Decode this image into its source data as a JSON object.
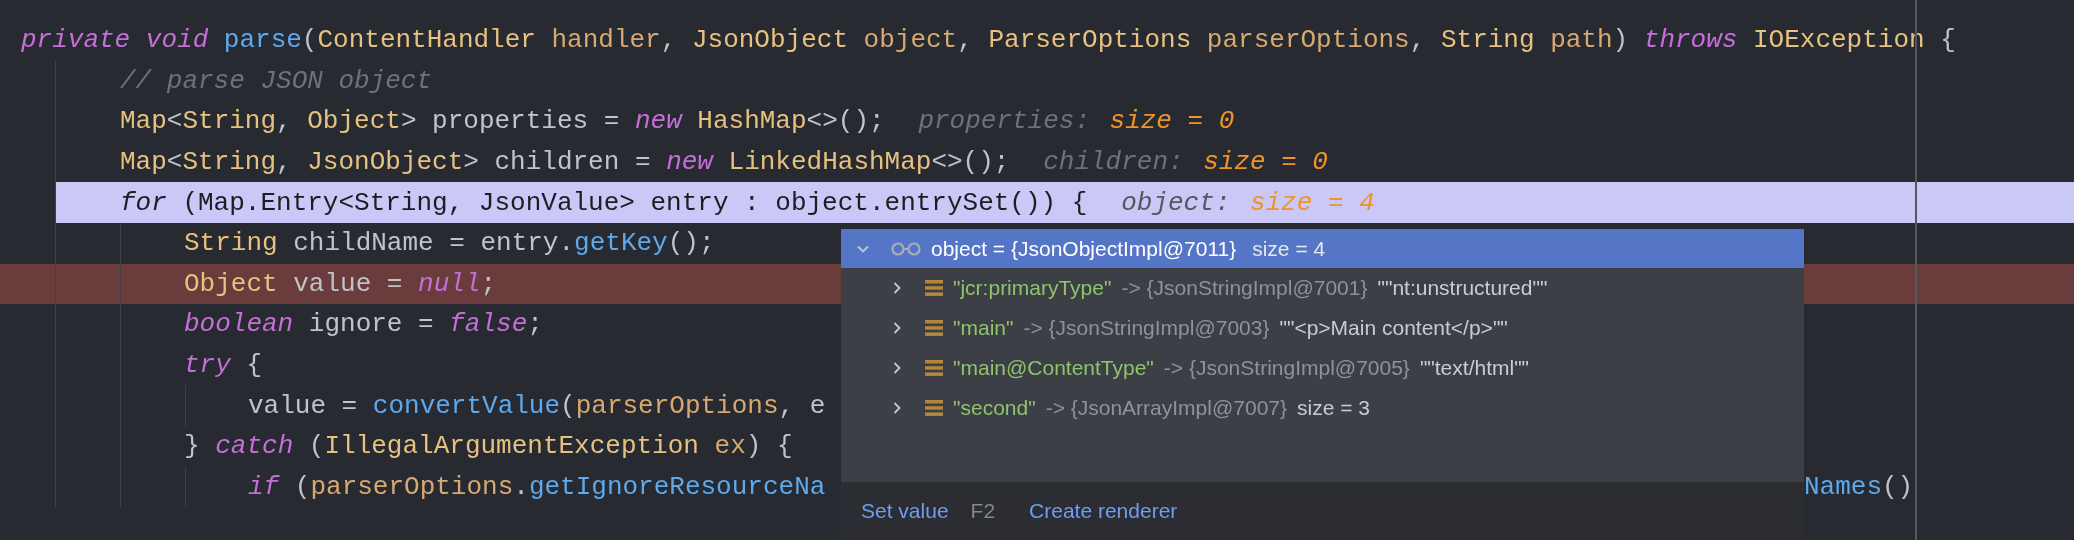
{
  "code": [
    {
      "current": false,
      "breakpoint": false,
      "segments": [
        {
          "kind": "kw",
          "text": "private"
        },
        {
          "kind": "kw",
          "text": " void"
        },
        {
          "kind": "method",
          "text": " parse"
        },
        {
          "kind": "plain",
          "text": "("
        },
        {
          "kind": "type",
          "text": "ContentHandler"
        },
        {
          "kind": "param",
          "text": " handler"
        },
        {
          "kind": "plain",
          "text": ", "
        },
        {
          "kind": "type",
          "text": "JsonObject"
        },
        {
          "kind": "param",
          "text": " object"
        },
        {
          "kind": "plain",
          "text": ", "
        },
        {
          "kind": "type",
          "text": "ParserOptions"
        },
        {
          "kind": "param",
          "text": " parserOptions"
        },
        {
          "kind": "plain",
          "text": ", "
        },
        {
          "kind": "type",
          "text": "String"
        },
        {
          "kind": "param",
          "text": " path"
        },
        {
          "kind": "plain",
          "text": ") "
        },
        {
          "kind": "kw",
          "text": "throws"
        },
        {
          "kind": "type",
          "text": " IOException"
        },
        {
          "kind": "plain",
          "text": " {"
        }
      ],
      "children": [
        {
          "current": false,
          "breakpoint": false,
          "segments": [
            {
              "kind": "comment",
              "text": "// parse JSON object"
            }
          ]
        },
        {
          "current": false,
          "breakpoint": false,
          "segments": [
            {
              "kind": "type",
              "text": "Map"
            },
            {
              "kind": "plain",
              "text": "<"
            },
            {
              "kind": "type",
              "text": "String"
            },
            {
              "kind": "plain",
              "text": ", "
            },
            {
              "kind": "type",
              "text": "Object"
            },
            {
              "kind": "plain",
              "text": "> properties = "
            },
            {
              "kind": "kw",
              "text": "new"
            },
            {
              "kind": "type",
              "text": " HashMap"
            },
            {
              "kind": "plain",
              "text": "<>();"
            }
          ],
          "hints": [
            {
              "label": "properties:",
              "value": "size = 0"
            }
          ]
        },
        {
          "current": false,
          "breakpoint": false,
          "segments": [
            {
              "kind": "type",
              "text": "Map"
            },
            {
              "kind": "plain",
              "text": "<"
            },
            {
              "kind": "type",
              "text": "String"
            },
            {
              "kind": "plain",
              "text": ", "
            },
            {
              "kind": "type",
              "text": "JsonObject"
            },
            {
              "kind": "plain",
              "text": "> children = "
            },
            {
              "kind": "kw",
              "text": "new"
            },
            {
              "kind": "type",
              "text": " LinkedHashMap"
            },
            {
              "kind": "plain",
              "text": "<>();"
            }
          ],
          "hints": [
            {
              "label": "children:",
              "value": "size = 0"
            }
          ]
        },
        {
          "current": true,
          "breakpoint": false,
          "segments": [
            {
              "kind": "kw",
              "text": "for"
            },
            {
              "kind": "plain",
              "text": " (Map.Entry<String, JsonValue> entry : object.entrySet()) {"
            }
          ],
          "hints": [
            {
              "label": "object:",
              "value": "size = 4"
            }
          ],
          "children": [
            {
              "current": false,
              "breakpoint": false,
              "segments": [
                {
                  "kind": "type",
                  "text": "String"
                },
                {
                  "kind": "plain",
                  "text": " childName = entry."
                },
                {
                  "kind": "method",
                  "text": "getKey"
                },
                {
                  "kind": "plain",
                  "text": "();"
                }
              ]
            },
            {
              "current": false,
              "breakpoint": true,
              "segments": [
                {
                  "kind": "type",
                  "text": "Object"
                },
                {
                  "kind": "plain",
                  "text": " value = "
                },
                {
                  "kind": "kw",
                  "text": "null"
                },
                {
                  "kind": "plain",
                  "text": ";"
                }
              ]
            },
            {
              "current": false,
              "breakpoint": false,
              "segments": [
                {
                  "kind": "kw",
                  "text": "boolean"
                },
                {
                  "kind": "plain",
                  "text": " ignore = "
                },
                {
                  "kind": "kw",
                  "text": "false"
                },
                {
                  "kind": "plain",
                  "text": ";"
                }
              ]
            },
            {
              "current": false,
              "breakpoint": false,
              "segments": [
                {
                  "kind": "kw",
                  "text": "try"
                },
                {
                  "kind": "plain",
                  "text": " {"
                }
              ],
              "children": [
                {
                  "current": false,
                  "breakpoint": false,
                  "segments": [
                    {
                      "kind": "plain",
                      "text": "value = "
                    },
                    {
                      "kind": "method",
                      "text": "convertValue"
                    },
                    {
                      "kind": "plain",
                      "text": "("
                    },
                    {
                      "kind": "param",
                      "text": "parserOptions"
                    },
                    {
                      "kind": "plain",
                      "text": ", e"
                    }
                  ]
                }
              ]
            },
            {
              "current": false,
              "breakpoint": false,
              "segments": [
                {
                  "kind": "plain",
                  "text": "} "
                },
                {
                  "kind": "kw",
                  "text": "catch"
                },
                {
                  "kind": "plain",
                  "text": " ("
                },
                {
                  "kind": "type",
                  "text": "IllegalArgumentException"
                },
                {
                  "kind": "param",
                  "text": " ex"
                },
                {
                  "kind": "plain",
                  "text": ") {"
                }
              ],
              "children": [
                {
                  "current": false,
                  "breakpoint": false,
                  "segments": [
                    {
                      "kind": "kw",
                      "text": "if"
                    },
                    {
                      "kind": "plain",
                      "text": " ("
                    },
                    {
                      "kind": "param",
                      "text": "parserOptions"
                    },
                    {
                      "kind": "plain",
                      "text": "."
                    },
                    {
                      "kind": "method",
                      "text": "getIgnoreResourceNa"
                    }
                  ],
                  "tail": [
                    {
                      "kind": "method",
                      "text": "Names"
                    },
                    {
                      "kind": "plain",
                      "text": "()"
                    }
                  ]
                }
              ]
            }
          ]
        }
      ]
    }
  ],
  "popup": {
    "tree": [
      {
        "kind": "watch",
        "label": "object = {JsonObjectImpl@7011}",
        "extra": "size = 4",
        "expanded": true,
        "selected": true,
        "children": [
          {
            "kind": "field",
            "key": "\"jcr:primaryType\"",
            "ref": "-> {JsonStringImpl@7001}",
            "value": "\"\"nt:unstructured\"\"",
            "expanded": false,
            "selected": false
          },
          {
            "kind": "field",
            "key": "\"main\"",
            "ref": "-> {JsonStringImpl@7003}",
            "value": "\"\"<p>Main content</p>\"\"",
            "expanded": false,
            "selected": false
          },
          {
            "kind": "field",
            "key": "\"main@ContentType\"",
            "ref": "-> {JsonStringImpl@7005}",
            "value": "\"\"text/html\"\"",
            "expanded": false,
            "selected": false
          },
          {
            "kind": "field",
            "key": "\"second\"",
            "ref": "-> {JsonArrayImpl@7007}",
            "value": "size = 3",
            "expanded": false,
            "selected": false
          }
        ]
      }
    ],
    "footer": [
      {
        "label": "Set value",
        "shortcut": "F2"
      },
      {
        "label": "Create renderer"
      }
    ]
  }
}
